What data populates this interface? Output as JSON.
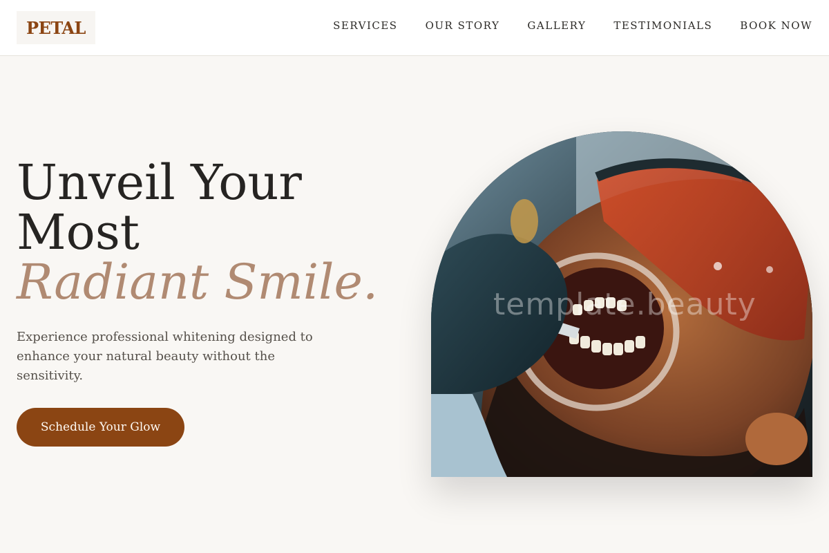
{
  "brand": {
    "logo_text": "PETAL",
    "brand_color": "#8b4513",
    "accent_color": "#b08a72"
  },
  "nav": {
    "items": [
      {
        "label": "SERVICES"
      },
      {
        "label": "OUR STORY"
      },
      {
        "label": "GALLERY"
      },
      {
        "label": "TESTIMONIALS"
      },
      {
        "label": "BOOK NOW"
      }
    ]
  },
  "hero": {
    "title_line1": "Unveil Your",
    "title_line2": "Most",
    "title_accent": "Radiant Smile.",
    "description": "Experience professional whitening designed to enhance your natural beauty without the sensitivity.",
    "cta_label": "Schedule Your Glow"
  },
  "image": {
    "description": "Patient in orange protective glasses receiving teeth whitening treatment from gloved dentist",
    "watermark": "template.beauty"
  }
}
